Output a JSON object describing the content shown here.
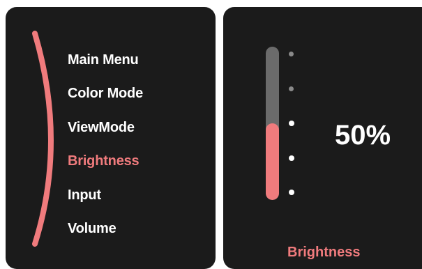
{
  "menu": {
    "items": [
      {
        "label": "Main Menu",
        "active": false
      },
      {
        "label": "Color Mode",
        "active": false
      },
      {
        "label": "ViewMode",
        "active": false
      },
      {
        "label": "Brightness",
        "active": true
      },
      {
        "label": "Input",
        "active": false
      },
      {
        "label": "Volume",
        "active": false
      }
    ]
  },
  "adjust": {
    "value_text": "50%",
    "level": 0.5,
    "title": "Brightness",
    "ticks": 5
  },
  "colors": {
    "panel_bg": "#1b1b1b",
    "accent": "#f07b7d",
    "text": "#ffffff",
    "track": "#6b6b6b",
    "tick_dim": "#8a8a8a",
    "tick_bright": "#ffffff"
  }
}
